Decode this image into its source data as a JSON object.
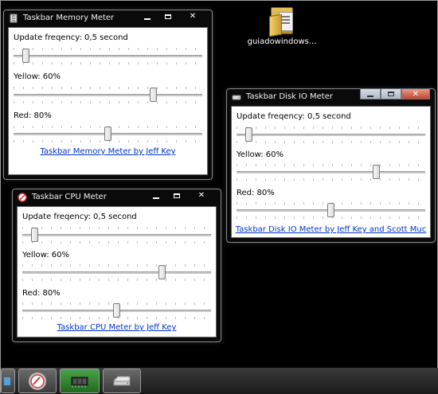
{
  "desktop_icon": {
    "label": "guiadowindows..."
  },
  "memory_window": {
    "title": "Taskbar Memory Meter",
    "update_label": "Update freqency: 0,5 second",
    "yellow_label": "Yellow: 60%",
    "red_label": "Red: 80%",
    "link": "Taskbar Memory Meter by Jeff Key",
    "sliders": {
      "update": 0.05,
      "yellow": 0.75,
      "red": 0.5
    }
  },
  "cpu_window": {
    "title": "Taskbar CPU Meter",
    "update_label": "Update freqency: 0,5 second",
    "yellow_label": "Yellow: 60%",
    "red_label": "Red: 80%",
    "link": "Taskbar CPU Meter by Jeff Key",
    "sliders": {
      "update": 0.05,
      "yellow": 0.75,
      "red": 0.5
    }
  },
  "disk_window": {
    "title": "Taskbar Disk IO Meter",
    "update_label": "Update freqency: 0,5 second",
    "yellow_label": "Yellow: 60%",
    "red_label": "Red: 80%",
    "link": "Taskbar Disk IO Meter by Jeff Key and Scott Muc",
    "sliders": {
      "update": 0.05,
      "yellow": 0.75,
      "red": 0.5
    }
  },
  "taskbar": {
    "items": [
      {
        "name": "partial-app-icon"
      },
      {
        "name": "cpu-meter-icon"
      },
      {
        "name": "memory-chip-icon"
      },
      {
        "name": "disk-drive-icon"
      }
    ]
  },
  "colors": {
    "link": "#0033cc",
    "accent_close": "#c4462d",
    "taskbar_active": "#2d7f2d"
  }
}
